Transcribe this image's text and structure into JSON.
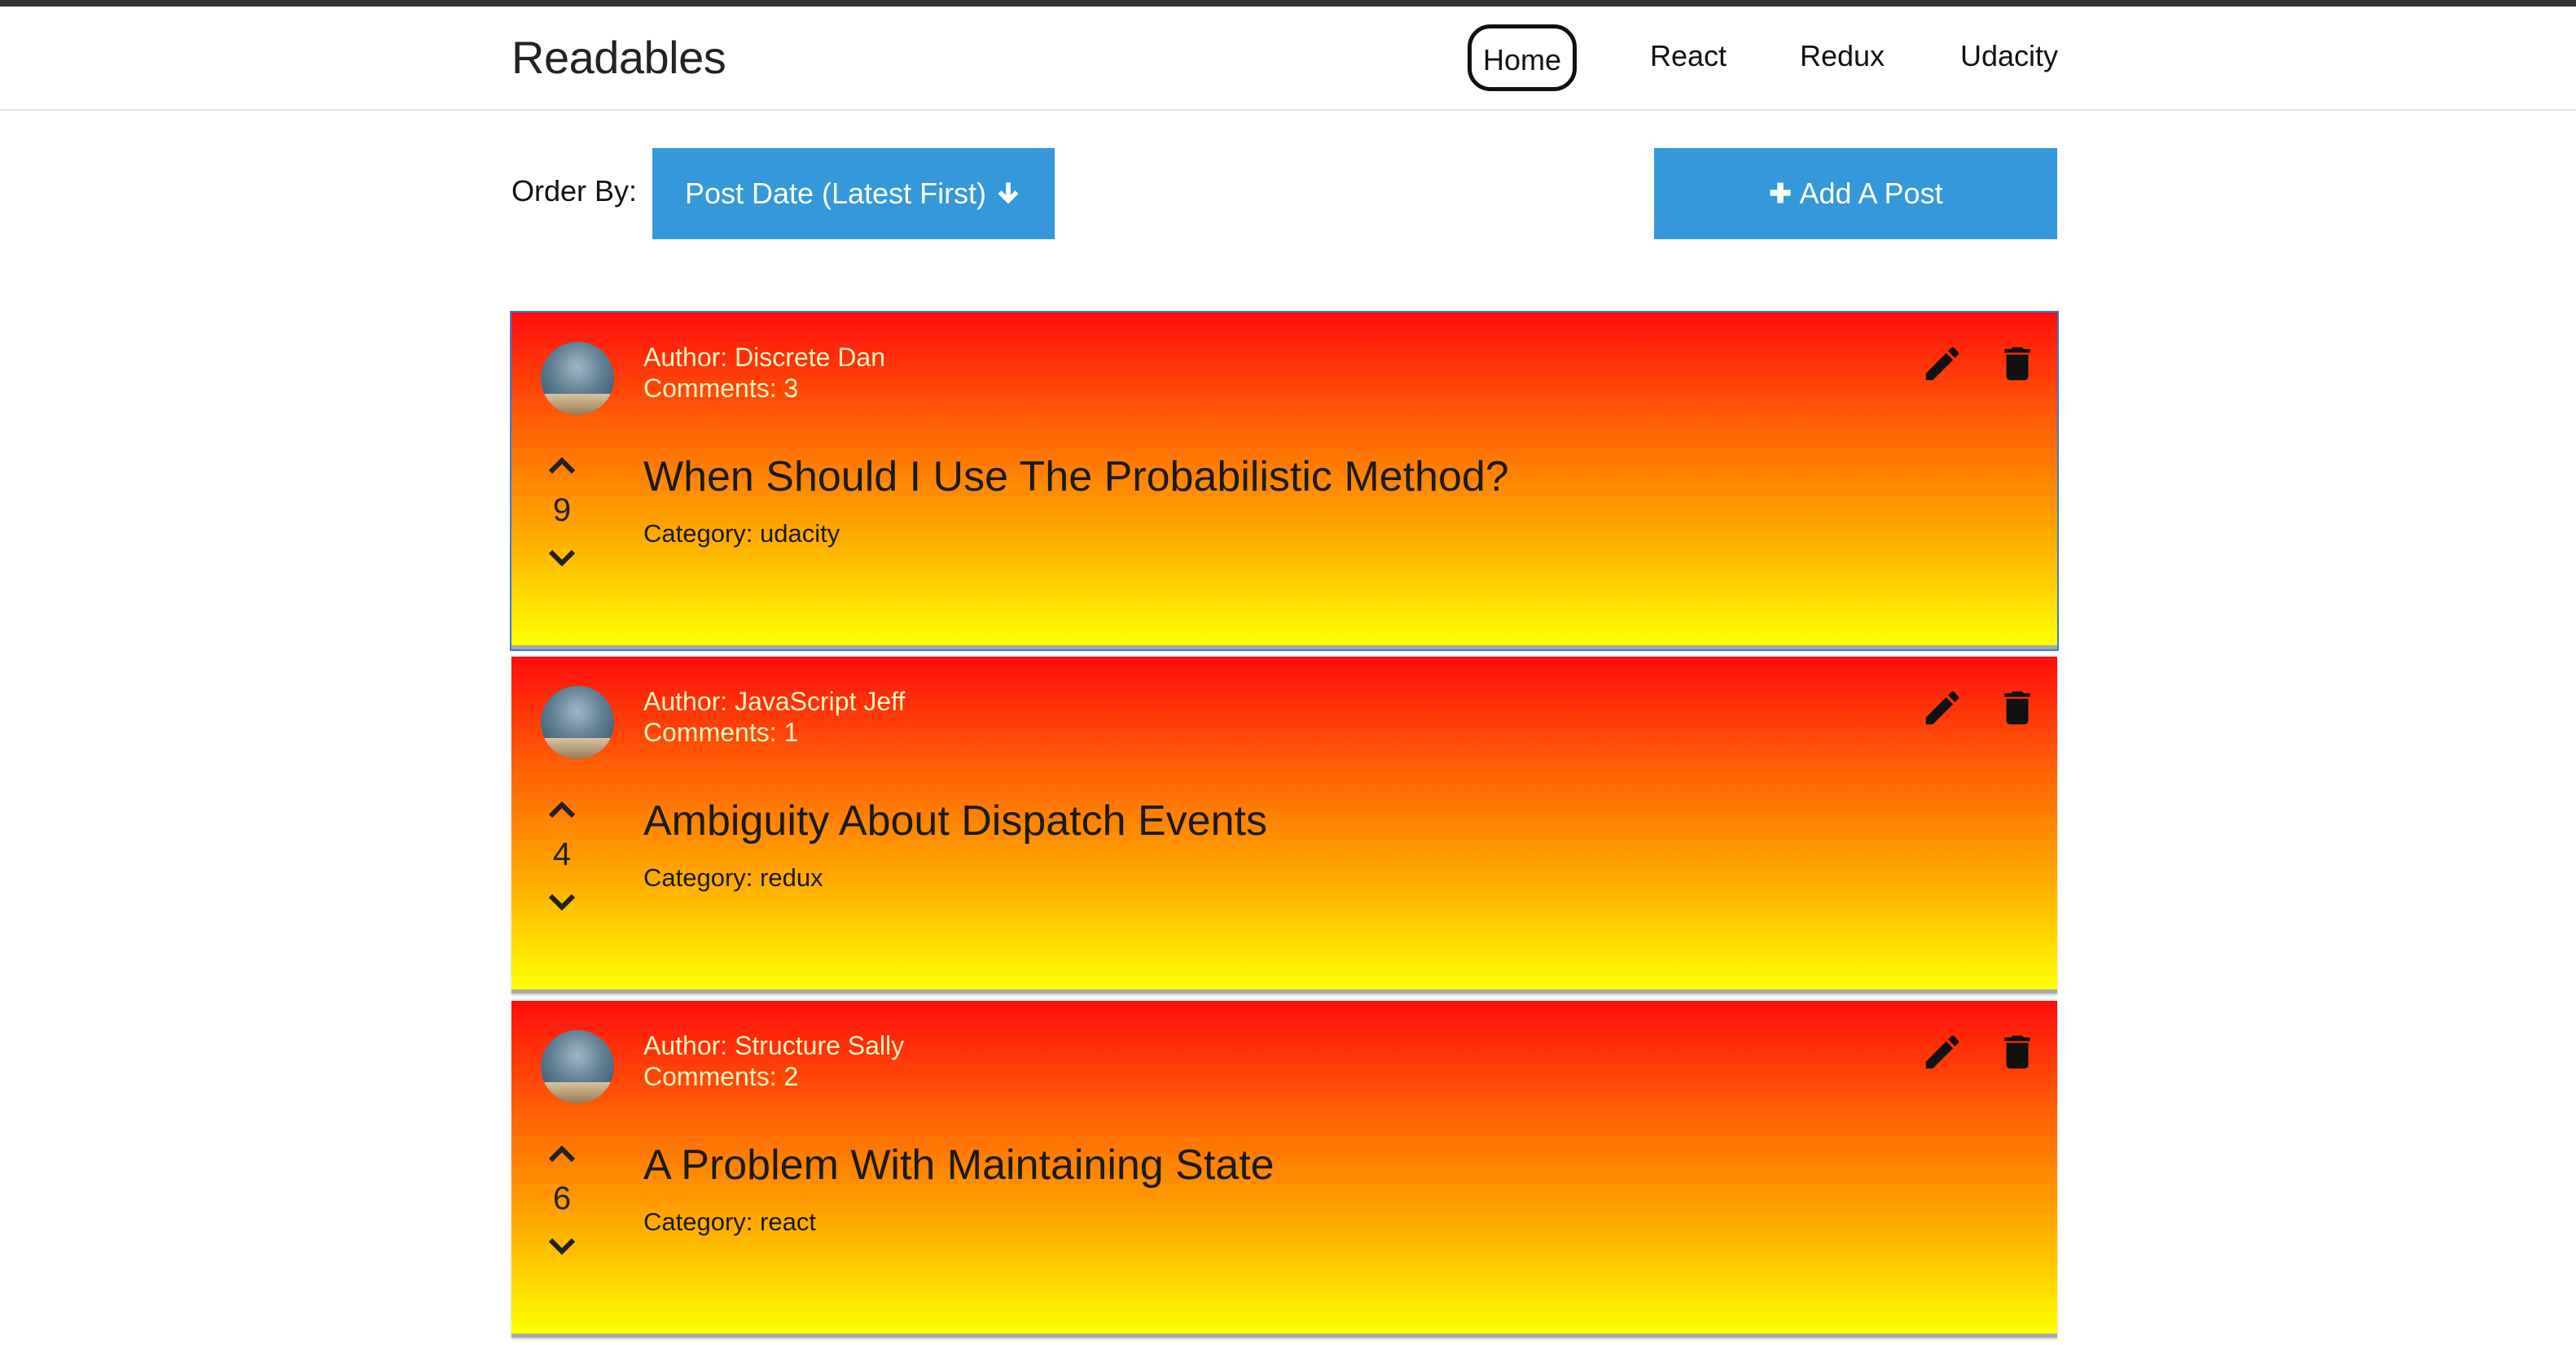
{
  "app": {
    "brand": "Readables"
  },
  "nav": {
    "items": [
      {
        "label": "Home",
        "active": true
      },
      {
        "label": "React",
        "active": false
      },
      {
        "label": "Redux",
        "active": false
      },
      {
        "label": "Udacity",
        "active": false
      }
    ]
  },
  "toolbar": {
    "order_by_label": "Order By:",
    "order_button_label": "Post Date (Latest First)",
    "order_icon": "arrow-down-icon",
    "add_button_label": "Add A Post",
    "add_icon": "plus-icon"
  },
  "colors": {
    "accent_blue": "#3498db",
    "card_gradient_top": "#ff0d0d",
    "card_gradient_bottom": "#ffff00",
    "meta_text": "#fff4c2"
  },
  "posts": [
    {
      "author": "Author: Discrete Dan",
      "comments": "Comments: 3",
      "title": "When Should I Use The Probabilistic Method?",
      "category": "Category: udacity",
      "votes": "9"
    },
    {
      "author": "Author: JavaScript Jeff",
      "comments": "Comments: 1",
      "title": "Ambiguity About Dispatch Events",
      "category": "Category: redux",
      "votes": "4"
    },
    {
      "author": "Author: Structure Sally",
      "comments": "Comments: 2",
      "title": "A Problem With Maintaining State",
      "category": "Category: react",
      "votes": "6"
    }
  ]
}
